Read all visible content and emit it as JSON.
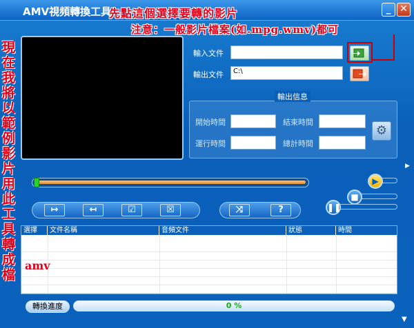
{
  "window": {
    "title": "AMV視頻轉換工具",
    "minimize_glyph": "_",
    "close_glyph": "✕"
  },
  "annotations": {
    "top_line1": "先點這個選擇要轉的影片",
    "top_line2": "注意：一般影片檔案(如.mpg.wmv)都可",
    "vertical": "現在我將以範例影片用此工具轉成檔",
    "amv": "amv"
  },
  "input": {
    "label": "輸入文件",
    "value": ""
  },
  "output": {
    "label": "輸出文件",
    "value": "C:\\"
  },
  "info": {
    "title": "輸出信息",
    "start_label": "開始時間",
    "start_value": "",
    "end_label": "結束時間",
    "end_value": "",
    "run_label": "運行時間",
    "run_value": "",
    "total_label": "總計時間",
    "total_value": ""
  },
  "seek": {
    "position": 0.0
  },
  "controls": {
    "mark_in": "↦",
    "mark_out": "↤",
    "check": "☑",
    "remove": "☒",
    "swap": "⤨",
    "help": "?"
  },
  "table": {
    "columns": [
      "選擇",
      "文件名稱",
      "音頻文件",
      "狀態",
      "時間"
    ],
    "rows": []
  },
  "convert": {
    "label": "轉換進度",
    "progress_text": "0 %",
    "progress": 0
  },
  "colors": {
    "frame": "#0b62bd",
    "annotation": "#e2001a",
    "progress": "#2ec02e"
  },
  "icons": [
    "open-file-icon",
    "save-file-icon",
    "gear-icon",
    "play-icon",
    "stop-icon",
    "pause-icon"
  ]
}
